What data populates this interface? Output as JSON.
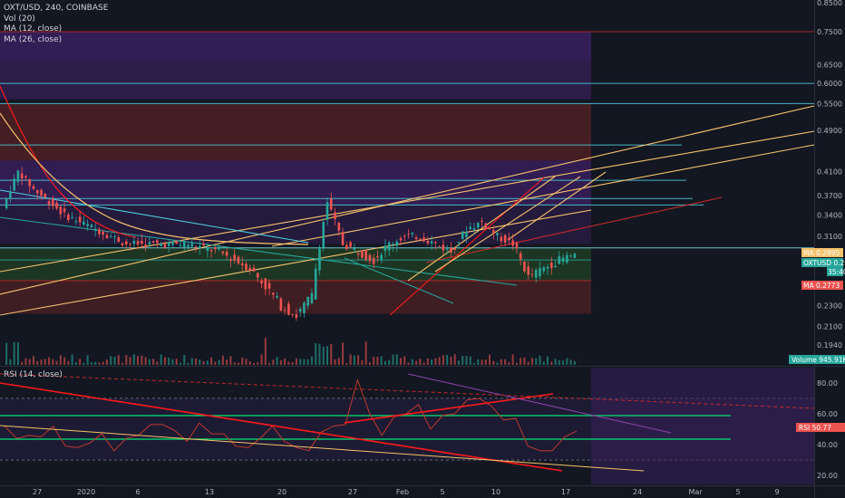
{
  "legend": {
    "symbol": "OXT/USD, 240, COINBASE",
    "vol": "Vol (20)",
    "ma1": "MA (12, close)",
    "ma2": "MA (26, close)",
    "rsi": "RSI (14, close)"
  },
  "colors": {
    "background": "#131722",
    "candle_up": "#26a69a",
    "candle_down": "#ef5350",
    "rsi_line": "#c0392b",
    "price_ma_orange": "#f7c26b",
    "trend_red": "#ff1a1a",
    "green_line": "#00e676",
    "zone_purple": "#3a1f5e",
    "zone_red": "#4a1f24",
    "zone_green": "#1f3a25"
  },
  "chart_data": [
    {
      "type": "candlestick",
      "title": "OXT/USD, 240, COINBASE",
      "y_scale": "log",
      "x_ticks": [
        "27",
        "2020",
        "6",
        "13",
        "20",
        "27",
        "Feb",
        "5",
        "10",
        "17",
        "24",
        "Mar",
        "5",
        "9"
      ],
      "y_ticks": [
        0.85,
        0.75,
        0.65,
        0.6,
        0.55,
        0.49,
        0.41,
        0.37,
        0.34,
        0.31,
        0.23,
        0.21,
        0.194
      ],
      "price_labels": [
        {
          "label": "MA",
          "value": "0.2895",
          "color": "#f7c26b"
        },
        {
          "label": "OXTUSD",
          "value": "0.2865",
          "color": "#26a69a"
        },
        {
          "label": "",
          "value": "35:40",
          "color": "#26a69a"
        },
        {
          "label": "MA",
          "value": "0.2773",
          "color": "#ef5350"
        }
      ],
      "horizontal_levels": [
        0.75,
        0.6,
        0.55,
        0.46,
        0.395,
        0.365,
        0.355,
        0.295,
        0.28,
        0.256
      ],
      "series_approx": [
        0.35,
        0.41,
        0.38,
        0.36,
        0.34,
        0.33,
        0.32,
        0.31,
        0.3,
        0.3,
        0.3,
        0.3,
        0.3,
        0.295,
        0.29,
        0.28,
        0.27,
        0.25,
        0.23,
        0.22,
        0.24,
        0.36,
        0.3,
        0.29,
        0.28,
        0.3,
        0.31,
        0.31,
        0.3,
        0.29,
        0.32,
        0.33,
        0.31,
        0.3,
        0.26,
        0.27,
        0.28,
        0.2865
      ]
    },
    {
      "type": "bar",
      "title": "Vol (20)",
      "price_label": {
        "label": "Volume",
        "value": "945.91K"
      }
    },
    {
      "type": "line",
      "title": "RSI (14, close)",
      "y_ticks": [
        80.0,
        60.0,
        40.0,
        20.0
      ],
      "bands": [
        70,
        30
      ],
      "price_label": {
        "label": "RSI",
        "value": "50.77"
      },
      "values_approx": [
        50,
        46,
        44,
        47,
        50,
        41,
        36,
        43,
        45,
        38,
        42,
        48,
        51,
        55,
        47,
        44,
        52,
        49,
        45,
        41,
        36,
        46,
        50,
        44,
        36,
        38,
        46,
        54,
        51,
        84,
        58,
        48,
        56,
        62,
        64,
        52,
        57,
        62,
        67,
        72,
        63,
        58,
        55,
        41,
        34,
        38,
        43,
        50.77
      ]
    }
  ]
}
